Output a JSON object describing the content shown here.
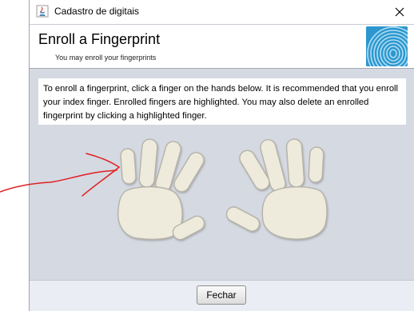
{
  "window": {
    "title": "Cadastro de digitais",
    "close_symbol": "✕"
  },
  "header": {
    "title": "Enroll a Fingerprint",
    "subtitle": "You may enroll your fingerprints",
    "logo_icon": "fingerprint-icon"
  },
  "instructions": "To enroll a fingerprint, click a finger on the hands below. It is recommended that you enroll your index finger. Enrolled fingers are highlighted. You may also delete an enrolled fingerprint by clicking a highlighted finger.",
  "hands": {
    "left": [
      "pinky",
      "ring",
      "middle",
      "index",
      "thumb"
    ],
    "right": [
      "thumb",
      "index",
      "middle",
      "ring",
      "pinky"
    ]
  },
  "footer": {
    "close_label": "Fechar"
  },
  "colors": {
    "content_bg": "#d5d9e2",
    "hand_fill": "#eeebdc",
    "hand_stroke": "#b5b3aa",
    "logo_blue": "#2c97cf",
    "annotation_red": "#e02020"
  }
}
